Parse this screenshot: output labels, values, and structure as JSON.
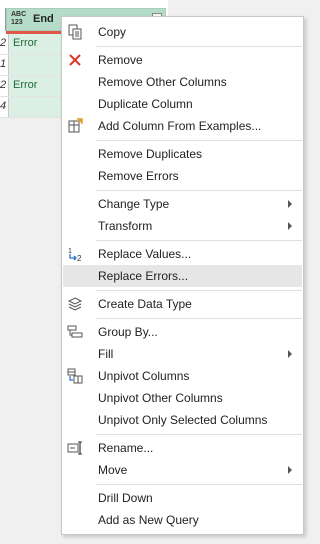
{
  "column": {
    "type_icon_top": "ABC",
    "type_icon_bottom": "123",
    "name": "End"
  },
  "rows": [
    {
      "index": "2",
      "value": "Error"
    },
    {
      "index": "1",
      "value": ""
    },
    {
      "index": "2",
      "value": "Error"
    },
    {
      "index": "4",
      "value": ""
    }
  ],
  "menu": {
    "items": [
      {
        "label": "Copy",
        "icon": "copy-icon"
      },
      {
        "label": "Remove",
        "icon": "remove-x-icon"
      },
      {
        "label": "Remove Other Columns"
      },
      {
        "label": "Duplicate Column"
      },
      {
        "label": "Add Column From Examples...",
        "icon": "add-column-examples-icon"
      },
      {
        "label": "Remove Duplicates"
      },
      {
        "label": "Remove Errors"
      },
      {
        "label": "Change Type",
        "submenu": true
      },
      {
        "label": "Transform",
        "submenu": true
      },
      {
        "label": "Replace Values...",
        "icon": "replace-values-icon"
      },
      {
        "label": "Replace Errors...",
        "highlighted": true
      },
      {
        "label": "Create Data Type",
        "icon": "create-data-type-icon"
      },
      {
        "label": "Group By...",
        "icon": "group-by-icon"
      },
      {
        "label": "Fill",
        "submenu": true
      },
      {
        "label": "Unpivot Columns",
        "icon": "unpivot-icon"
      },
      {
        "label": "Unpivot Other Columns"
      },
      {
        "label": "Unpivot Only Selected Columns"
      },
      {
        "label": "Rename...",
        "icon": "rename-icon"
      },
      {
        "label": "Move",
        "submenu": true
      },
      {
        "label": "Drill Down"
      },
      {
        "label": "Add as New Query"
      }
    ],
    "replace_values_icon_text": {
      "top": "1",
      "bottom": "2"
    }
  },
  "colors": {
    "header_green": "#b5dcc8",
    "cell_green": "#dcefe5",
    "error_red": "#e0584a",
    "valid_green": "#3ba86a",
    "highlight": "#e6e6e6",
    "remove_icon_red": "#d9382b"
  }
}
